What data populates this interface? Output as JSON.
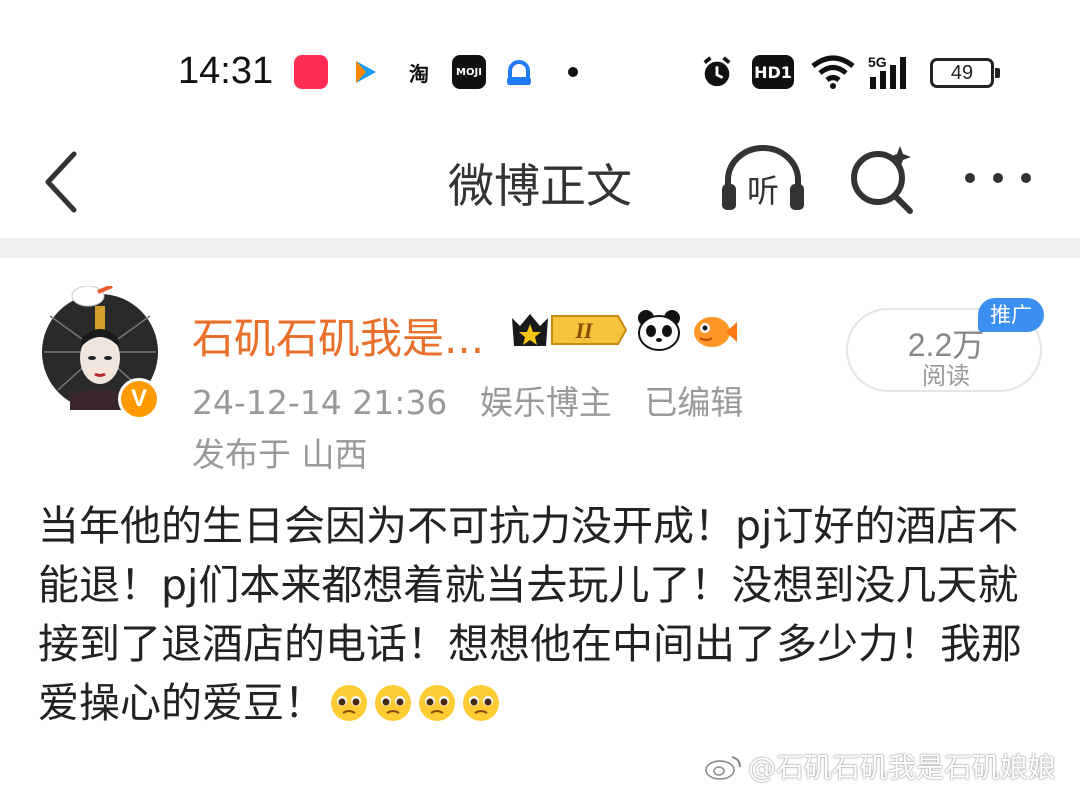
{
  "status_bar": {
    "time": "14:31",
    "app_icons": [
      "xiaohongshu-icon",
      "tencent-video-icon",
      "taobao-icon",
      "moji-weather-icon",
      "ai-icon",
      "dot-icon"
    ],
    "taobao_glyph": "淘",
    "moji_text": "MOJI",
    "hd_label": "HD1",
    "network_label": "5G",
    "battery_level": "49"
  },
  "header": {
    "title": "微博正文",
    "listen_label": "听"
  },
  "post": {
    "username": "石矶石矶我是...",
    "verified_mark": "V",
    "level_badge": "II",
    "timestamp": "24-12-14 21:36",
    "category": "娱乐博主",
    "edited": "已编辑",
    "location": "发布于 山西",
    "read_count": "2.2万",
    "read_label": "阅读",
    "promo_tag": "推广",
    "text": "当年他的生日会因为不可抗力没开成！pj订好的酒店不能退！pj们本来都想着就当去玩儿了！没想到没几天就接到了退酒店的电话！想想他在中间出了多少力！我那爱操心的爱豆！",
    "emoji_count": 4
  },
  "watermark": "@石矶石矶我是石矶娘娘",
  "colors": {
    "username": "#e8702a",
    "verified": "#ff9a00",
    "promo": "#3b8ff0",
    "meta": "#999999"
  }
}
